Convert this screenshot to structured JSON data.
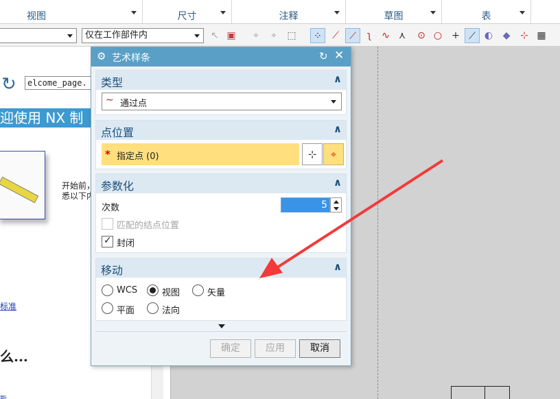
{
  "ribbon": {
    "groups": [
      {
        "label": "视图"
      },
      {
        "label": "尺寸"
      },
      {
        "label": "注释"
      },
      {
        "label": "草图"
      },
      {
        "label": "表"
      }
    ]
  },
  "toolbar": {
    "filter_value": "",
    "scope_value": "仅在工作部件内"
  },
  "welcome": {
    "url_value": "elcome_page.",
    "banner": "迎使用 NX 制",
    "paragraph_line1": "开始前，",
    "paragraph_line2": "悉以下内",
    "link1": "标准",
    "heading": "么...",
    "link2": "能"
  },
  "dialog": {
    "title": "艺术样条",
    "type_section": {
      "title": "类型",
      "selected": "通过点"
    },
    "point_section": {
      "title": "点位置",
      "specify_point": "指定点 (0)"
    },
    "param_section": {
      "title": "参数化",
      "degree_label": "次数",
      "degree_value": "5",
      "match_knots_label": "匹配的结点位置",
      "match_knots_checked": false,
      "match_knots_enabled": false,
      "closed_label": "封闭",
      "closed_checked": true
    },
    "move_section": {
      "title": "移动",
      "options": [
        "WCS",
        "视图",
        "矢量",
        "平面",
        "法向"
      ],
      "selected": "视图"
    },
    "buttons": {
      "ok": "确定",
      "apply": "应用",
      "cancel": "取消"
    }
  },
  "colors": {
    "title_bar": "#5aa0c6",
    "section_header": "#dde9f2",
    "required_field": "#ffdf7e",
    "selected_spin": "#3a93e6",
    "annotation_arrow": "#f23a3a"
  }
}
